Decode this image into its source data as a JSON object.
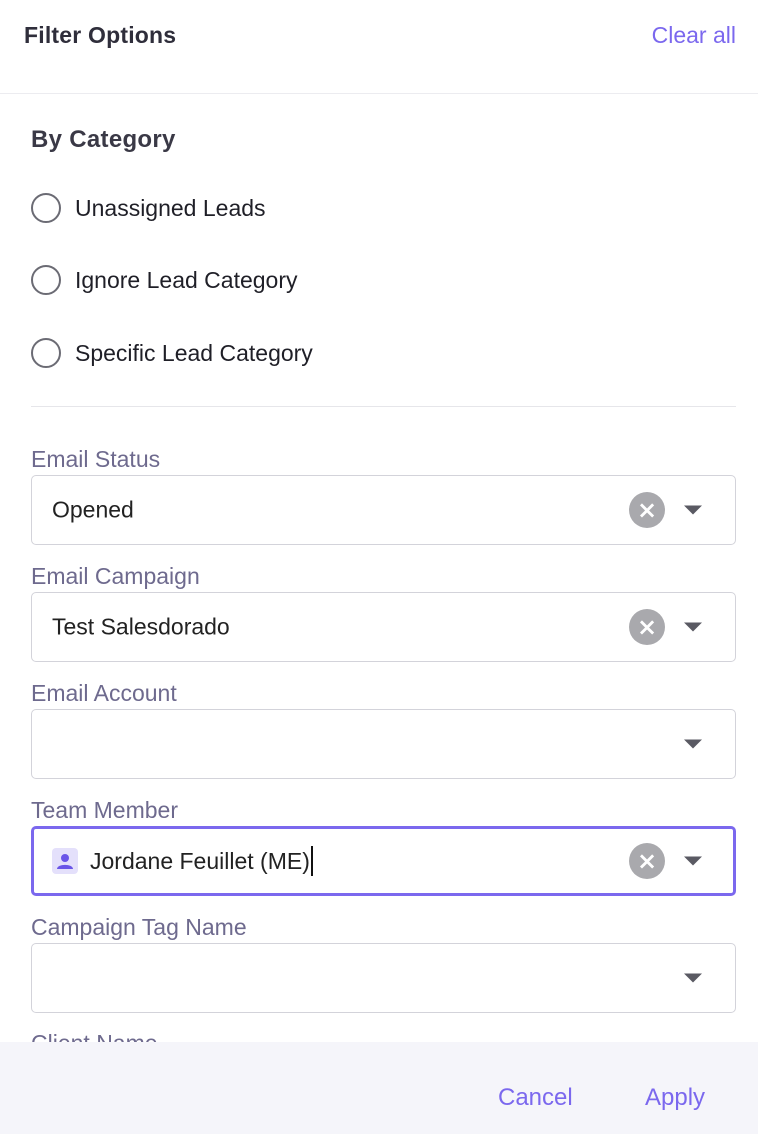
{
  "header": {
    "title": "Filter Options",
    "clear_all_label": "Clear all"
  },
  "category": {
    "title": "By Category",
    "options": [
      {
        "label": "Unassigned Leads",
        "selected": false
      },
      {
        "label": "Ignore Lead Category",
        "selected": false
      },
      {
        "label": "Specific Lead Category",
        "selected": false
      }
    ]
  },
  "fields": {
    "email_status": {
      "label": "Email Status",
      "value": "Opened"
    },
    "email_campaign": {
      "label": "Email Campaign",
      "value": "Test Salesdorado"
    },
    "email_account": {
      "label": "Email Account",
      "value": ""
    },
    "team_member": {
      "label": "Team Member",
      "value": "Jordane Feuillet (ME)"
    },
    "campaign_tag_name": {
      "label": "Campaign Tag Name",
      "value": ""
    },
    "client_name": {
      "label": "Client Name"
    }
  },
  "footer": {
    "cancel_label": "Cancel",
    "apply_label": "Apply"
  },
  "icons": {
    "clear": "close-circle-icon",
    "dropdown": "caret-down-icon",
    "member": "user-icon"
  },
  "colors": {
    "accent": "#7b68ee",
    "label": "#6e6a8e",
    "footer_bg": "#f5f5fa",
    "clear_button": "#a9a9ad"
  }
}
